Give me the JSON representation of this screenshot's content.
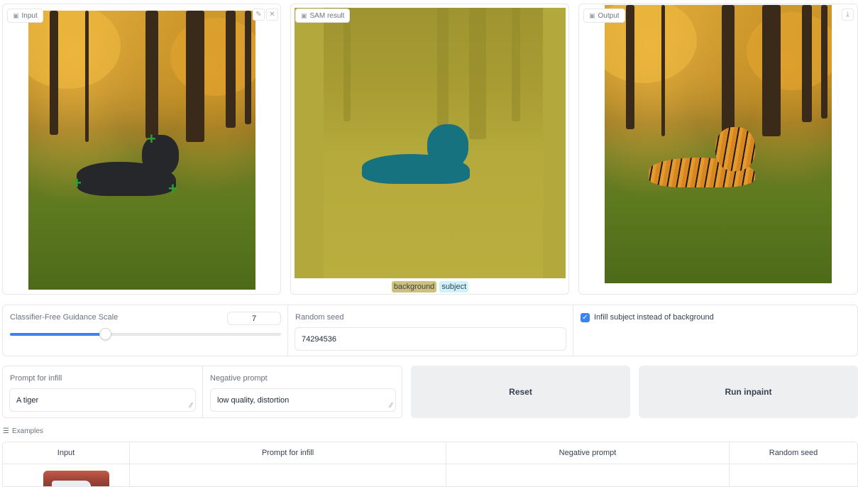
{
  "panels": {
    "input": {
      "label": "Input"
    },
    "sam": {
      "label": "SAM result",
      "legend": [
        "background",
        "subject"
      ]
    },
    "output": {
      "label": "Output"
    }
  },
  "icons": {
    "panel": "image-icon",
    "edit": "pencil-icon",
    "clear": "close-icon",
    "download": "download-icon",
    "examples": "menu-icon"
  },
  "controls": {
    "cfg": {
      "label": "Classifier-Free Guidance Scale",
      "value": "7",
      "fraction": 0.35
    },
    "seed": {
      "label": "Random seed",
      "value": "74294536"
    },
    "infill": {
      "label": "Infill subject instead of background",
      "checked": true
    }
  },
  "prompts": {
    "infill": {
      "label": "Prompt for infill",
      "value": "A tiger"
    },
    "negative": {
      "label": "Negative prompt",
      "value": "low quality, distortion"
    }
  },
  "buttons": {
    "reset": "Reset",
    "run": "Run inpaint"
  },
  "examples": {
    "title": "Examples",
    "columns": [
      "Input",
      "Prompt for infill",
      "Negative prompt",
      "Random seed"
    ]
  },
  "colors": {
    "accent": "#3b82f6",
    "sam_background": "#b3a83c",
    "sam_subject": "#17727f"
  }
}
